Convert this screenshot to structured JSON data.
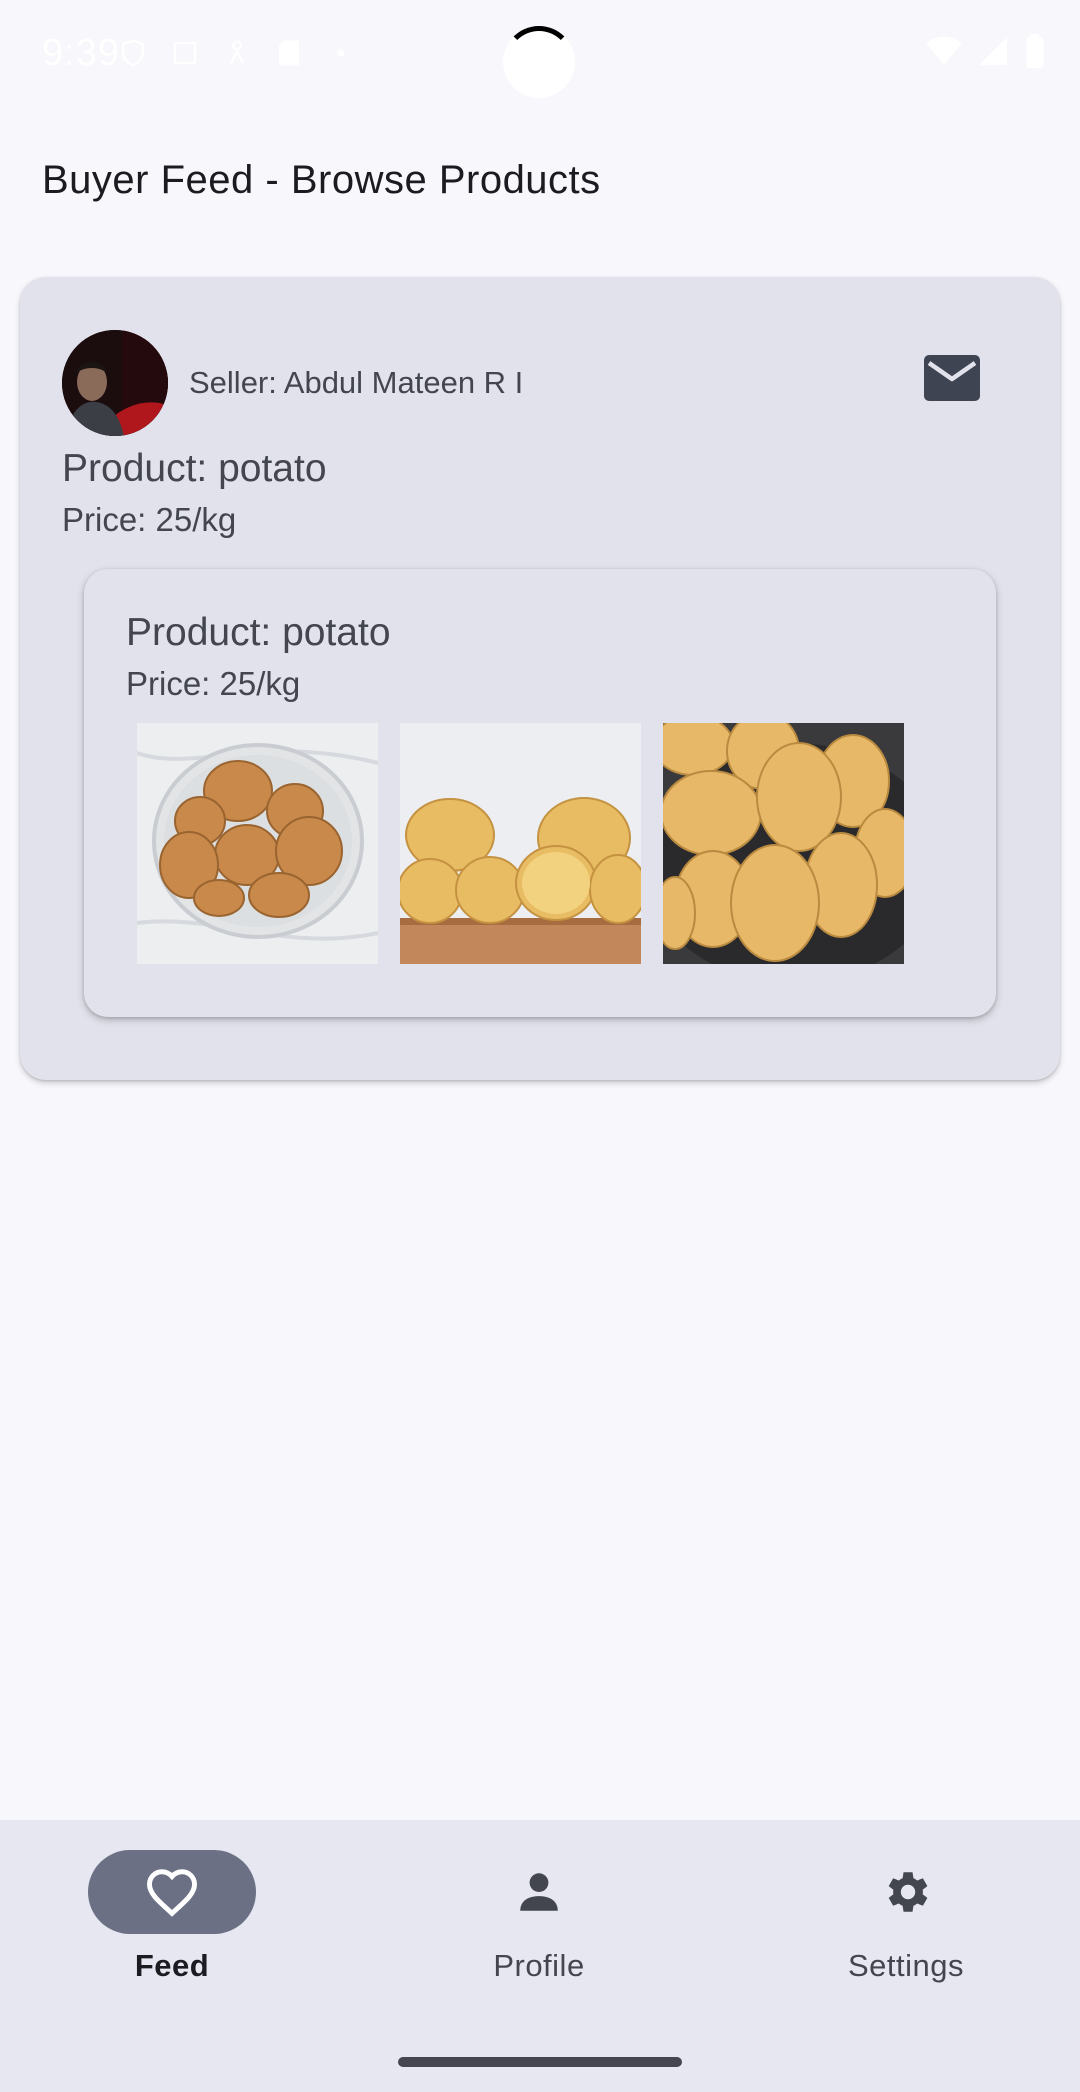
{
  "status_bar": {
    "time": "9:39"
  },
  "header": {
    "title": "Buyer Feed - Browse Products"
  },
  "post": {
    "seller": "Seller: Abdul Mateen R I",
    "product": "Product: potato",
    "price": "Price: 25/kg",
    "item": {
      "product": "Product: potato",
      "price": "Price: 25/kg",
      "images": [
        "potatoes-in-glass-bowl",
        "potatoes-on-wooden-board",
        "potatoes-in-dark-pan"
      ]
    }
  },
  "bottom_nav": {
    "items": [
      {
        "label": "Feed",
        "icon": "heart-icon",
        "active": true
      },
      {
        "label": "Profile",
        "icon": "person-icon",
        "active": false
      },
      {
        "label": "Settings",
        "icon": "gear-icon",
        "active": false
      }
    ]
  },
  "colors": {
    "background": "#f7f7fc",
    "card": "#e2e2ec",
    "nav_active_pill": "#6b7085",
    "text_secondary": "#44464f"
  }
}
